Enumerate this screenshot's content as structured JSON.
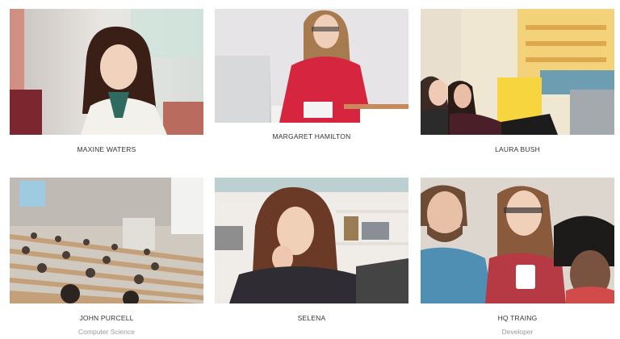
{
  "colors": {
    "name_text": "#333333",
    "role_text": "#9a9a9a",
    "background": "#ffffff"
  },
  "team": [
    {
      "name": "MAXINE WATERS",
      "role": "",
      "photo_icon": "woman-reading-photo"
    },
    {
      "name": "MARGARET HAMILTON",
      "role": "",
      "photo_icon": "woman-laptop-photo"
    },
    {
      "name": "LAURA BUSH",
      "role": "",
      "photo_icon": "women-library-photo"
    },
    {
      "name": "JOHN PURCELL",
      "role": "Computer Science",
      "photo_icon": "lecture-hall-photo"
    },
    {
      "name": "SELENA",
      "role": "",
      "photo_icon": "student-thinking-photo"
    },
    {
      "name": "HQ TRAING",
      "role": "Developer",
      "photo_icon": "group-tablet-photo"
    }
  ]
}
